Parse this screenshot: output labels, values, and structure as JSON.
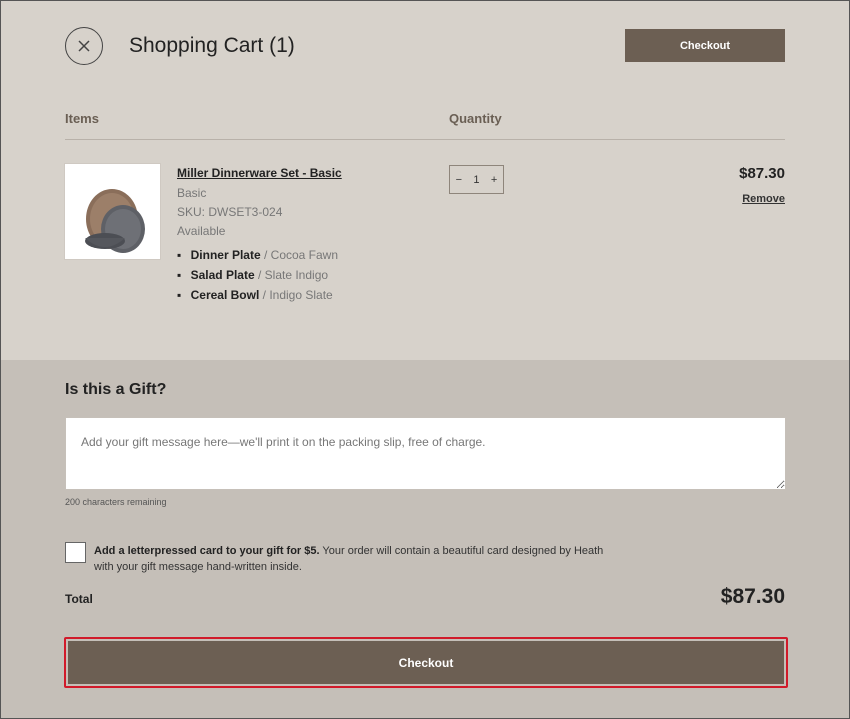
{
  "header": {
    "title": "Shopping Cart (1)",
    "checkout_label": "Checkout"
  },
  "columns": {
    "items": "Items",
    "quantity": "Quantity"
  },
  "cart": {
    "items": [
      {
        "name": "Miller Dinnerware Set - Basic",
        "variant": "Basic",
        "sku": "SKU: DWSET3-024",
        "availability": "Available",
        "components": [
          {
            "name": "Dinner Plate",
            "color": "Cocoa Fawn"
          },
          {
            "name": "Salad Plate",
            "color": "Slate Indigo"
          },
          {
            "name": "Cereal Bowl",
            "color": "Indigo Slate"
          }
        ],
        "quantity": "1",
        "price": "$87.30",
        "remove_label": "Remove"
      }
    ]
  },
  "stepper": {
    "minus": "−",
    "plus": "+"
  },
  "gift": {
    "title": "Is this a Gift?",
    "placeholder": "Add your gift message here—we'll print it on the packing slip, free of charge.",
    "chars_remaining": "200 characters remaining",
    "card_offer_bold": "Add a letterpressed card to your gift for $5.",
    "card_offer_rest": " Your order will contain a beautiful card designed by Heath with your gift message hand-written inside."
  },
  "totals": {
    "label": "Total",
    "value": "$87.30"
  },
  "footer": {
    "checkout_label": "Checkout"
  },
  "colors": {
    "button": "#6c5f53",
    "highlight": "#d11a2a",
    "top_bg": "#d7d2cb",
    "bottom_bg": "#c5bfb8"
  },
  "icons": {
    "close": "close-icon",
    "product": "dinnerware-set-image"
  }
}
